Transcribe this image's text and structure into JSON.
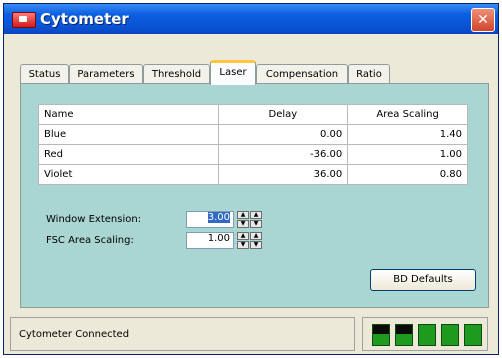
{
  "window": {
    "title": "Cytometer",
    "close_label": "✕"
  },
  "tabs": [
    {
      "label": "Status",
      "active": false
    },
    {
      "label": "Parameters",
      "active": false
    },
    {
      "label": "Threshold",
      "active": false
    },
    {
      "label": "Laser",
      "active": true
    },
    {
      "label": "Compensation",
      "active": false
    },
    {
      "label": "Ratio",
      "active": false
    }
  ],
  "laser_table": {
    "headers": [
      "Name",
      "Delay",
      "Area Scaling"
    ],
    "rows": [
      {
        "name": "Blue",
        "delay": "0.00",
        "area_scaling": "1.40"
      },
      {
        "name": "Red",
        "delay": "-36.00",
        "area_scaling": "1.00"
      },
      {
        "name": "Violet",
        "delay": "36.00",
        "area_scaling": "0.80"
      }
    ]
  },
  "fields": {
    "window_extension": {
      "label": "Window Extension:",
      "value": "3.00"
    },
    "fsc_area_scaling": {
      "label": "FSC Area Scaling:",
      "value": "1.00"
    }
  },
  "buttons": {
    "bd_defaults": "BD Defaults"
  },
  "status": {
    "text": "Cytometer Connected"
  },
  "indicators": [
    {
      "state": "split"
    },
    {
      "state": "split"
    },
    {
      "state": "on"
    },
    {
      "state": "on"
    },
    {
      "state": "on"
    }
  ],
  "colors": {
    "panel": "#a9d5d2",
    "titlebar": "#0a55d8",
    "indicator_on": "#1e9a1e",
    "indicator_off": "#0a0a0a"
  }
}
